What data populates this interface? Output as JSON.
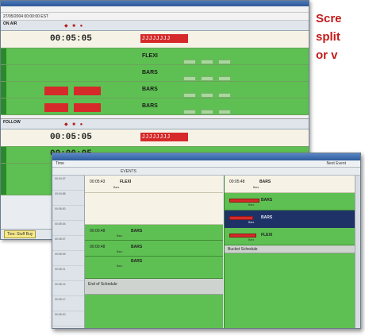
{
  "caption": {
    "lines": [
      "Scre",
      "split",
      "or v"
    ],
    "color": "#c41a1a"
  },
  "back_window": {
    "date_bar": "27/05/2004   00:00:00  EST",
    "panel1": {
      "name": "ON AIR",
      "timecode": "00:05:05",
      "rows": [
        {
          "kind": "cream",
          "timecode": "00:05:05",
          "red_box": "JJJJJJJJ"
        },
        {
          "kind": "green",
          "label": "FLEXI"
        },
        {
          "kind": "green",
          "label": "BARS"
        },
        {
          "kind": "green",
          "label": "BARS"
        },
        {
          "kind": "green",
          "label": "BARS"
        }
      ]
    },
    "panel2": {
      "name": "FOLLOW",
      "rows": [
        {
          "kind": "cream",
          "timecode": "00:05:05",
          "red_box": "JJJJJJJJ"
        },
        {
          "kind": "green",
          "timecode": "00:00:05"
        }
      ]
    },
    "status_bar": {
      "chip": "Ties: Stuff Buy"
    }
  },
  "front_window": {
    "toolbar_left": "Time",
    "toolbar_right": "Next Event",
    "column_head": "EVENTS",
    "time_labels": [
      "00:04:37",
      "00:04:58",
      "00:05:00",
      "00:05:04",
      "00:05:07",
      "00:05:09",
      "00:05:11",
      "00:05:14",
      "00:05:17",
      "00:05:20"
    ],
    "lane1": {
      "blocks": [
        {
          "kind": "cream",
          "time": "00:05:43",
          "label": "FLEXI",
          "sub": "Bars"
        },
        {
          "kind": "green",
          "time": "00:00:48",
          "label": "BARS",
          "sub": "Bars"
        },
        {
          "kind": "green",
          "time": "00:00:48",
          "label": "BARS",
          "sub": "Bars"
        },
        {
          "kind": "green",
          "label": "BARS",
          "sub": "Bars"
        },
        {
          "kind": "gray",
          "label": "End of Schedule"
        }
      ]
    },
    "lane2": {
      "blocks": [
        {
          "kind": "cream",
          "time": "00:05:48",
          "label": "BARS",
          "sub": "Bars"
        },
        {
          "kind": "green",
          "label": "BARS",
          "sub": "Bars"
        },
        {
          "kind": "navy",
          "label": "BARS",
          "sub": "Bars"
        },
        {
          "kind": "green",
          "label": "FLEXI",
          "sub": "Bars"
        },
        {
          "kind": "gray",
          "label": "Bucket Schedule"
        }
      ]
    }
  }
}
